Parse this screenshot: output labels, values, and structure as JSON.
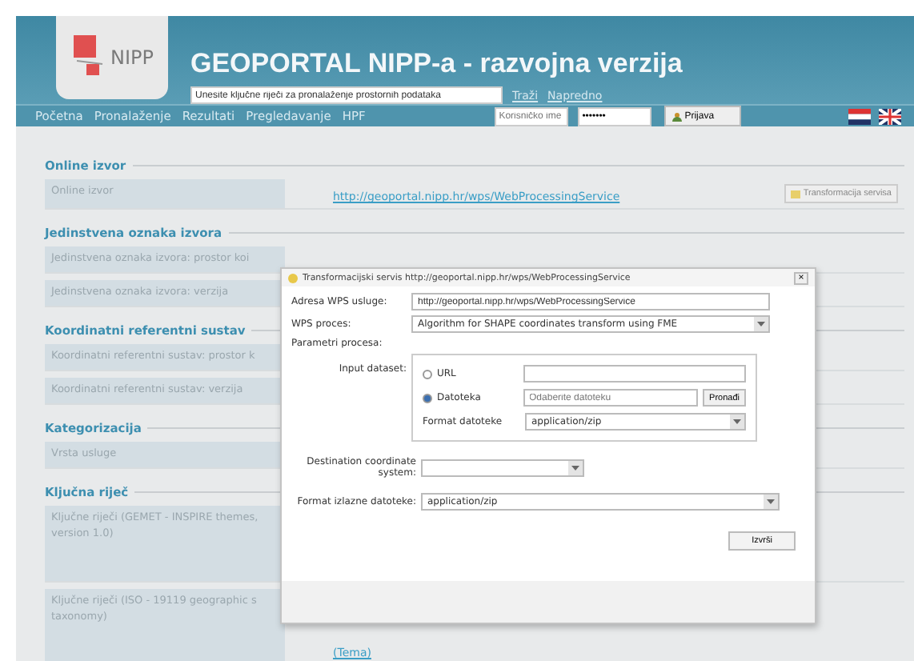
{
  "header": {
    "logo": "NIPP",
    "title": "GEOPORTAL NIPP-a - razvojna verzija",
    "search": {
      "value": "Unesite ključne riječi za pronalaženje prostornih podataka"
    },
    "links": [
      "Traži",
      "Napredno"
    ]
  },
  "nav": {
    "items": [
      {
        "label": "Početna",
        "selected": false
      },
      {
        "label": "Pronalaženje",
        "selected": false
      },
      {
        "label": "Rezultati",
        "selected": false
      },
      {
        "label": "Pregledavanje",
        "selected": false
      },
      {
        "label": "HPF",
        "selected": false
      }
    ],
    "username": {
      "placeholder": "Korisničko ime"
    },
    "password": {
      "value": "•••••••"
    },
    "login": "Prijava"
  },
  "sections": [
    {
      "title": "Online izvor",
      "rows": [
        {
          "label": "Online izvor",
          "link": "http://geoportal.nipp.hr/wps/WebProcessingService",
          "button": "Transformacija servisa"
        }
      ]
    },
    {
      "title": "Jedinstvena oznaka izvora",
      "rows": [
        {
          "label": "Jedinstvena oznaka izvora: prostor koi"
        },
        {
          "label": "Jedinstvena oznaka izvora: verzija"
        }
      ]
    },
    {
      "title": "Koordinatni referentni sustav",
      "rows": [
        {
          "label": "Koordinatni referentni sustav: prostor k"
        },
        {
          "label": "Koordinatni referentni sustav: verzija"
        }
      ]
    },
    {
      "title": "Kategorizacija",
      "rows": [
        {
          "label": "Vrsta usluge"
        }
      ]
    },
    {
      "title": "Ključna riječ",
      "rows": [
        {
          "label": "Ključne riječi (GEMET - INSPIRE themes, version 1.0)",
          "tall": true
        },
        {
          "label": "Ključne riječi (ISO - 19119 geographic s taxonomy)",
          "link": "(Tema)",
          "tall": true
        }
      ]
    }
  ],
  "dialog": {
    "title": "Transformacijski servis http://geoportal.nipp.hr/wps/WebProcessingService",
    "close": "×",
    "address_label": "Adresa WPS usluge:",
    "address": "http://geoportal.nipp.hr/wps/WebProcessingService",
    "process_label": "WPS proces:",
    "process": "Algorithm for SHAPE coordinates transform using FME",
    "params_label": "Parametri procesa:",
    "input_label": "Input dataset:",
    "sources": [
      {
        "label": "URL",
        "selected": false
      },
      {
        "label": "Datoteka",
        "selected": true
      }
    ],
    "file": {
      "placeholder": "Odaberite datoteku"
    },
    "browse": "Pronađi",
    "format_label": "Format datoteke",
    "format": "application/zip",
    "dest_label": "Destination coordinate system:",
    "out_label": "Format izlazne datoteke:",
    "out_format": "application/zip",
    "run": "Izvrši"
  }
}
